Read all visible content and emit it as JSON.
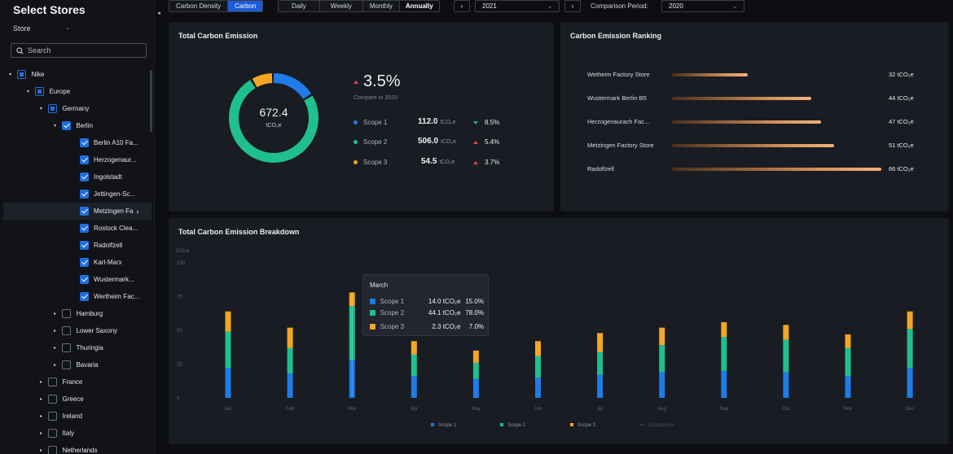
{
  "sidebar": {
    "title": "Select Stores",
    "filter_label": "Store",
    "search_placeholder": "Search",
    "tree": [
      {
        "label": "Nike",
        "caret": "▾",
        "state": "partial",
        "level": 0
      },
      {
        "label": "Europe",
        "caret": "▾",
        "state": "partial",
        "level": 1
      },
      {
        "label": "Germany",
        "caret": "▾",
        "state": "partial",
        "level": 2
      },
      {
        "label": "Berlin",
        "caret": "▾",
        "state": "checked",
        "level": 3
      },
      {
        "label": "Berlin A10 Fa...",
        "caret": "",
        "state": "checked",
        "level": 4
      },
      {
        "label": "Herzogenaur...",
        "caret": "",
        "state": "checked",
        "level": 4
      },
      {
        "label": "Ingolstadt",
        "caret": "",
        "state": "checked",
        "level": 4
      },
      {
        "label": "Jettingen-Sc...",
        "caret": "",
        "state": "checked",
        "level": 4
      },
      {
        "label": "Metzingen Fa",
        "caret": "",
        "state": "checked",
        "level": 4,
        "selected": true
      },
      {
        "label": "Rostock Clea...",
        "caret": "",
        "state": "checked",
        "level": 4
      },
      {
        "label": "Radolfzell",
        "caret": "",
        "state": "checked",
        "level": 4
      },
      {
        "label": "Karl-Marx",
        "caret": "",
        "state": "checked",
        "level": 4
      },
      {
        "label": "Wustermark...",
        "caret": "",
        "state": "checked",
        "level": 4
      },
      {
        "label": "Wertheim Fac...",
        "caret": "",
        "state": "checked",
        "level": 4
      },
      {
        "label": "Hamburg",
        "caret": "▸",
        "state": "unchecked",
        "level": 3
      },
      {
        "label": "Lower Saxony",
        "caret": "▸",
        "state": "unchecked",
        "level": 3
      },
      {
        "label": "Thuringia",
        "caret": "▸",
        "state": "unchecked",
        "level": 3
      },
      {
        "label": "Bavaria",
        "caret": "▸",
        "state": "unchecked",
        "level": 3
      },
      {
        "label": "France",
        "caret": "▸",
        "state": "unchecked",
        "level": 2
      },
      {
        "label": "Greece",
        "caret": "▸",
        "state": "unchecked",
        "level": 2
      },
      {
        "label": "Ireland",
        "caret": "▸",
        "state": "unchecked",
        "level": 2
      },
      {
        "label": "Italy",
        "caret": "▸",
        "state": "unchecked",
        "level": 2
      },
      {
        "label": "Netherlands",
        "caret": "▸",
        "state": "unchecked",
        "level": 2
      }
    ]
  },
  "toolbar": {
    "metric_tabs": [
      "Carbon Density",
      "Carbon"
    ],
    "metric_active": 1,
    "period_tabs": [
      "Daily",
      "Weekly",
      "Monthly",
      "Annually"
    ],
    "period_active": 3,
    "year": "2021",
    "comparison_label": "Comparison Period:",
    "comparison_year": "2020"
  },
  "total": {
    "title": "Total Carbon Emission",
    "center_value": "672.4",
    "center_unit": "tCO₂e",
    "change": "3.5%",
    "compare_text": "Compare to 2020",
    "scopes": [
      {
        "name": "Scope 1",
        "value": "112.0",
        "unit": "tCO₂e",
        "change": "8.5%",
        "direction": "down",
        "color": "#1f7be8"
      },
      {
        "name": "Scope 2",
        "value": "506.0",
        "unit": "tCO₂e",
        "change": "5.4%",
        "direction": "up",
        "color": "#1fbf8f"
      },
      {
        "name": "Scope 3",
        "value": "54.5",
        "unit": "tCO₂e",
        "change": "3.7%",
        "direction": "up",
        "color": "#f5a623"
      }
    ]
  },
  "ranking": {
    "title": "Carbon Emission Ranking",
    "items": [
      {
        "label": "Wetheim Factory Store",
        "value": 32,
        "value_text": "32 tCO₂e"
      },
      {
        "label": "Wustermark Berlin B5",
        "value": 44,
        "value_text": "44 tCO₂e"
      },
      {
        "label": "Herzogenaurach Fac...",
        "value": 47,
        "value_text": "47 tCO₂e"
      },
      {
        "label": "Metzingen Factory Store",
        "value": 51,
        "value_text": "51 tCO₂e"
      },
      {
        "label": "Radolfzell",
        "value": 66,
        "value_text": "66 tCO₂e"
      }
    ]
  },
  "breakdown": {
    "title": "Total Carbon Emission Breakdown",
    "tooltip": {
      "title": "March",
      "rows": [
        {
          "name": "Scope 1",
          "value": "14.0 tCO₂e",
          "pct": "15.0%",
          "color": "#1f7be8"
        },
        {
          "name": "Scope 2",
          "value": "44.1 tCO₂e",
          "pct": "78.0%",
          "color": "#1fbf8f"
        },
        {
          "name": "Scope 3",
          "value": "2.3 tCO₂e",
          "pct": "7.0%",
          "color": "#f5a623"
        }
      ]
    }
  },
  "chart_data": {
    "type": "bar",
    "stacked": true,
    "ylabel": "tCO₂e",
    "ylim": [
      0,
      100
    ],
    "yticks": [
      0,
      25,
      50,
      75,
      100
    ],
    "categories": [
      "Jan",
      "Feb",
      "Mar",
      "Apr",
      "May",
      "Jun",
      "Jul",
      "Aug",
      "Sep",
      "Oct",
      "Nov",
      "Dec"
    ],
    "highlight_index": 2,
    "series": [
      {
        "name": "Scope 1",
        "color": "#1f7be8",
        "values": [
          22,
          18,
          28,
          16,
          14,
          15,
          17,
          19,
          20,
          19,
          16,
          22
        ]
      },
      {
        "name": "Scope 2",
        "color": "#1fbf8f",
        "values": [
          27,
          19,
          40,
          16,
          12,
          16,
          17,
          20,
          25,
          24,
          21,
          29
        ]
      },
      {
        "name": "Scope 3",
        "color": "#f5a623",
        "values": [
          15,
          15,
          10,
          10,
          9,
          11,
          14,
          13,
          11,
          11,
          10,
          13
        ]
      }
    ],
    "legend": [
      "Scope 1",
      "Scope 2",
      "Scope 3",
      "Comparison"
    ],
    "legend_position": "bottom"
  }
}
